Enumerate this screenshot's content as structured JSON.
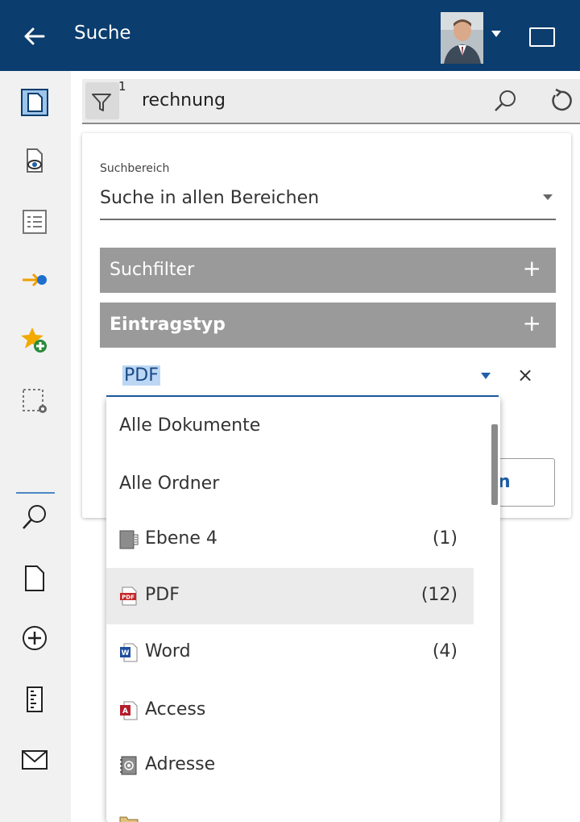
{
  "header": {
    "title": "Suche",
    "bg_color": "#0b3d6e"
  },
  "rail": {
    "items": [
      {
        "icon": "document-icon",
        "active": true
      },
      {
        "icon": "document-preview-icon"
      },
      {
        "icon": "list-view-icon"
      },
      {
        "icon": "workflow-arrow-icon"
      },
      {
        "icon": "favorite-add-icon"
      },
      {
        "icon": "selection-settings-icon"
      },
      {
        "icon": "search-icon"
      },
      {
        "icon": "new-document-icon"
      },
      {
        "icon": "add-circle-icon"
      },
      {
        "icon": "ruler-icon"
      },
      {
        "icon": "mail-icon"
      }
    ]
  },
  "searchbar": {
    "filter_count": "1",
    "query": "rechnung"
  },
  "scope": {
    "label": "Suchbereich",
    "value": "Suche in allen Bereichen"
  },
  "sections": {
    "suchfilter": "Suchfilter",
    "eintragstyp": "Eintragstyp",
    "plus": "+"
  },
  "type_field": {
    "value": "PDF",
    "clear": "×"
  },
  "hidden_button": {
    "label_fragment": "n"
  },
  "dropdown": {
    "items": [
      {
        "label": "Alle Dokumente",
        "count": "",
        "icon": ""
      },
      {
        "label": "Alle Ordner",
        "count": "",
        "icon": ""
      },
      {
        "label": "Ebene 4",
        "count": "(1)",
        "icon": "folder-level-icon"
      },
      {
        "label": "PDF",
        "count": "(12)",
        "icon": "pdf-icon",
        "selected": true
      },
      {
        "label": "Word",
        "count": "(4)",
        "icon": "word-icon"
      },
      {
        "label": "Access",
        "count": "",
        "icon": "access-icon"
      },
      {
        "label": "Adresse",
        "count": "",
        "icon": "address-book-icon"
      }
    ]
  },
  "colors": {
    "accent": "#1f5fa8",
    "section_bg": "#9a9a9a",
    "selection_highlight": "#bcd7f4"
  }
}
